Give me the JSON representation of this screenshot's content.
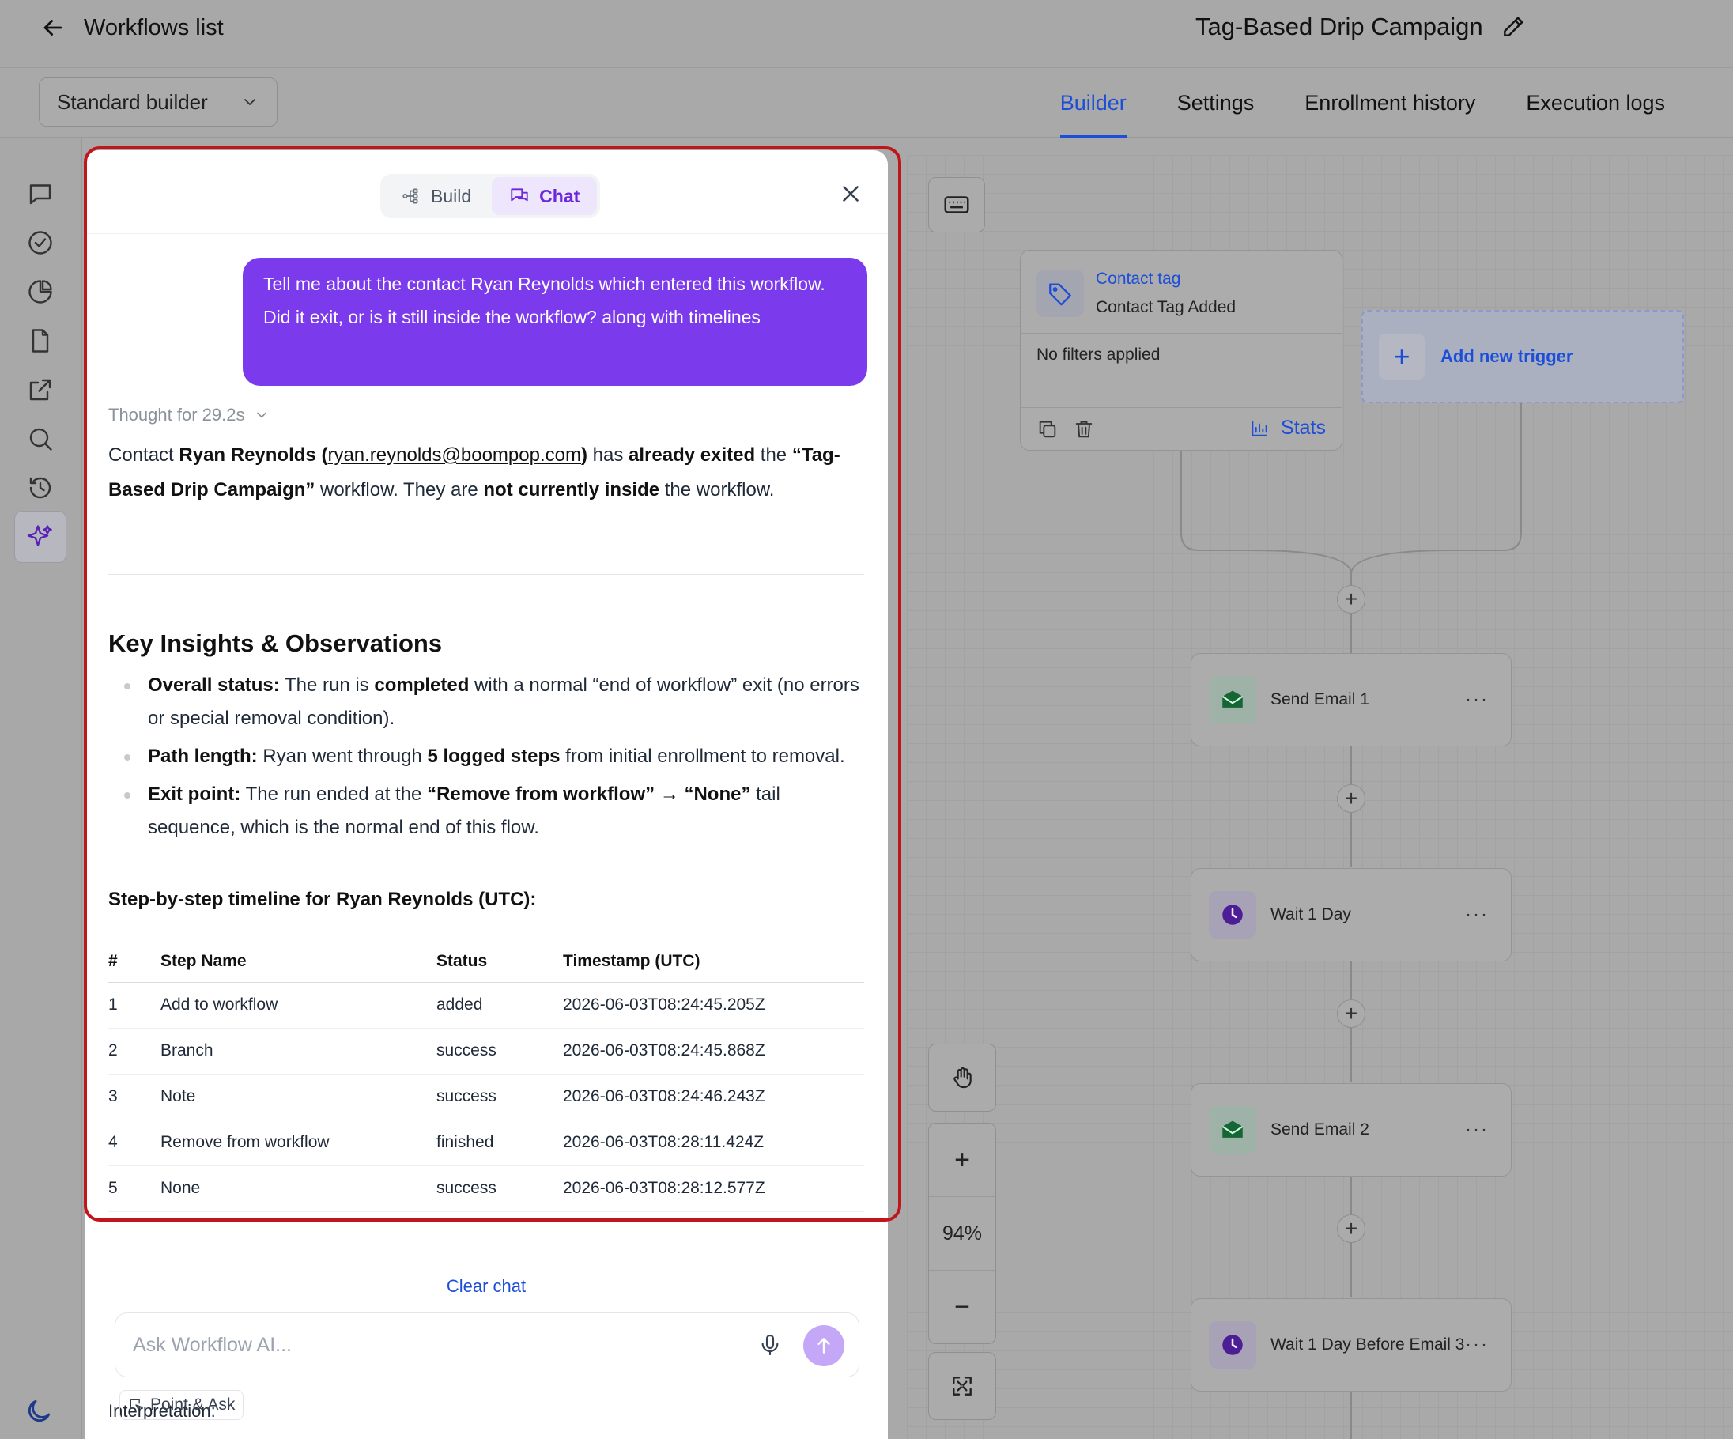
{
  "header": {
    "back_label": "Workflows list",
    "workflow_title": "Tag-Based Drip Campaign"
  },
  "subbar": {
    "builder_select": "Standard builder",
    "tabs": [
      {
        "label": "Builder",
        "active": true
      },
      {
        "label": "Settings",
        "active": false
      },
      {
        "label": "Enrollment history",
        "active": false
      },
      {
        "label": "Execution logs",
        "active": false
      }
    ]
  },
  "rail": {
    "icons": [
      "chat-icon",
      "check-circle-icon",
      "pie-chart-icon",
      "document-icon",
      "external-link-icon",
      "search-icon",
      "history-icon",
      "sparkles-icon"
    ],
    "active": "sparkles-icon",
    "bottom_icon": "moon-icon"
  },
  "panel": {
    "mode_build": "Build",
    "mode_chat": "Chat",
    "active_mode": "Chat",
    "user_message": "Tell me about the contact Ryan Reynolds which entered this workflow. Did it exit, or is it still inside the workflow? along with timelines",
    "thought": "Thought for 29.2s",
    "answer": {
      "p1_a": "Contact ",
      "p1_name": "Ryan Reynolds",
      "p1_open": " (",
      "p1_email": "ryan.reynolds@boompop.com",
      "p1_close": ")",
      "p1_b": " has ",
      "p1_exited": "already exited",
      "p1_c": " the ",
      "p1_wf": "“Tag-Based Drip Campaign”",
      "p1_d": " workflow. They are ",
      "p1_not": "not currently inside",
      "p1_e": " the workflow."
    },
    "insights_heading": "Key Insights & Observations",
    "bullets": [
      {
        "label": "Overall status:",
        "t1": " The run is ",
        "bold": "completed",
        "t2": " with a normal “end of workflow” exit (no errors or special removal condition)."
      },
      {
        "label": "Path length:",
        "t1": " Ryan went through ",
        "bold": "5 logged steps",
        "t2": " from initial enrollment to removal."
      },
      {
        "label": "Exit point:",
        "t1": " The run ended at the ",
        "bold": "“Remove from workflow” → “None”",
        "t2": " tail sequence, which is the normal end of this flow."
      }
    ],
    "timeline_heading": "Step-by-step timeline for Ryan Reynolds (UTC):",
    "table": {
      "headers": [
        "#",
        "Step Name",
        "Status",
        "Timestamp (UTC)"
      ],
      "rows": [
        [
          "1",
          "Add to workflow",
          "added",
          "2026-06-03T08:24:45.205Z"
        ],
        [
          "2",
          "Branch",
          "success",
          "2026-06-03T08:24:45.868Z"
        ],
        [
          "3",
          "Note",
          "success",
          "2026-06-03T08:24:46.243Z"
        ],
        [
          "4",
          "Remove from workflow",
          "finished",
          "2026-06-03T08:28:11.424Z"
        ],
        [
          "5",
          "None",
          "success",
          "2026-06-03T08:28:12.577Z"
        ]
      ]
    },
    "interpretation": "Interpretation:",
    "clear_chat": "Clear chat",
    "input_placeholder": "Ask Workflow AI...",
    "point_ask": "Point & Ask"
  },
  "canvas": {
    "trigger": {
      "title": "Contact tag",
      "subtitle": "Contact Tag Added",
      "filters": "No filters applied",
      "stats_label": "Stats"
    },
    "add_trigger": "Add new trigger",
    "steps": [
      {
        "label": "Send Email 1",
        "type": "email"
      },
      {
        "label": "Wait 1 Day",
        "type": "wait"
      },
      {
        "label": "Send Email 2",
        "type": "email"
      },
      {
        "label": "Wait 1 Day Before Email 3",
        "type": "wait"
      }
    ],
    "zoom": "94%"
  },
  "colors": {
    "accent_blue": "#1d4ed8",
    "accent_purple": "#7c3aed",
    "highlight_red": "#c0161b"
  }
}
